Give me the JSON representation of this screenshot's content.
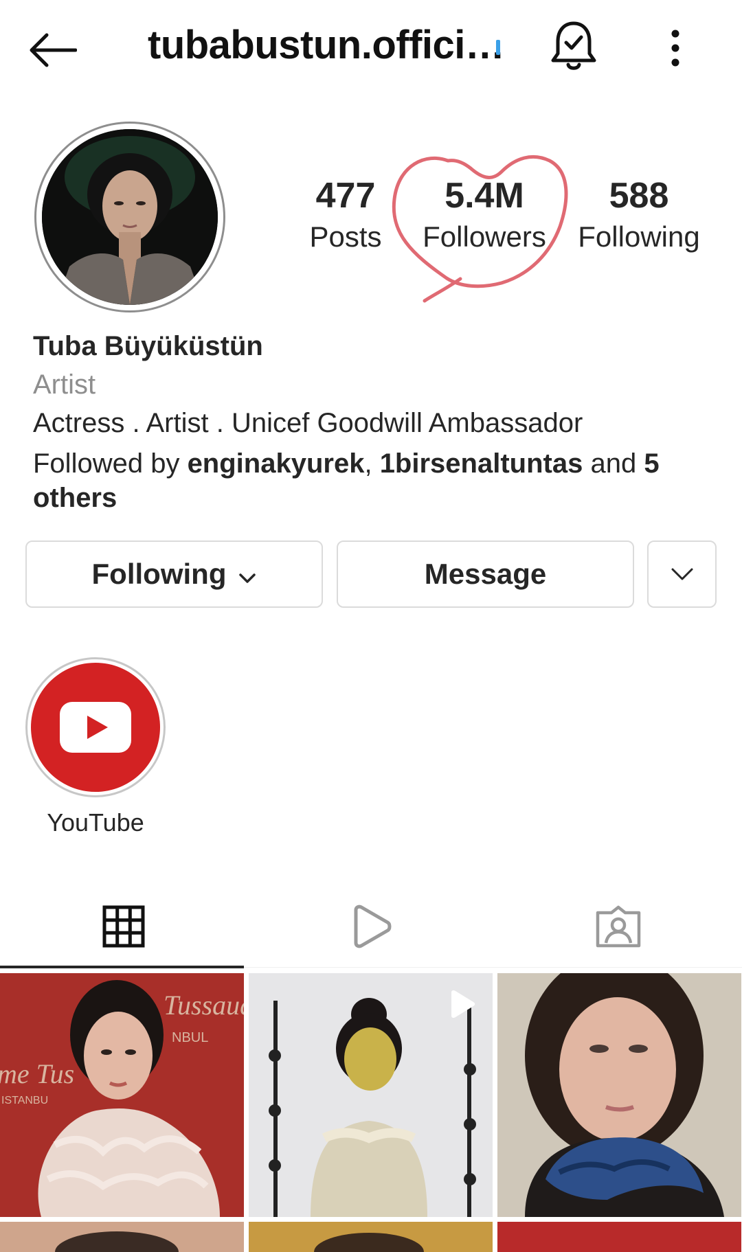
{
  "header": {
    "username": "tubabustun.offici…",
    "back_icon": "arrow-left-icon",
    "bell_icon": "bell-check-icon",
    "menu_icon": "more-vertical-icon"
  },
  "profile": {
    "stats": {
      "posts_value": "477",
      "posts_label": "Posts",
      "followers_value": "5.4M",
      "followers_label": "Followers",
      "following_value": "588",
      "following_label": "Following"
    },
    "full_name": "Tuba Büyüküstün",
    "category": "Artist",
    "bio": "Actress . Artist . Unicef Goodwill Ambassador",
    "followed_by": {
      "prefix": "Followed by ",
      "user1": "enginakyurek",
      "sep": ", ",
      "user2": "1birsenaltuntas",
      "and": " and ",
      "others": "5 others"
    }
  },
  "actions": {
    "following_label": "Following",
    "message_label": "Message"
  },
  "highlights": [
    {
      "label": "YouTube",
      "icon": "youtube-icon"
    }
  ],
  "tabs": [
    {
      "icon": "grid-icon",
      "active": true
    },
    {
      "icon": "reels-icon",
      "active": false
    },
    {
      "icon": "tagged-icon",
      "active": false
    }
  ],
  "grid": {
    "posts": [
      {
        "kind": "photo",
        "overlay_text_1": "Tussaud",
        "overlay_text_2": "NBUL",
        "overlay_text_3": "me Tus",
        "overlay_text_4": "ISTANBU"
      },
      {
        "kind": "reel"
      },
      {
        "kind": "photo"
      }
    ]
  },
  "colors": {
    "annotation_heart": "#e06a73",
    "youtube_red": "#d32223",
    "secondary_text": "#8e8e8e",
    "border": "#dbdbdb"
  }
}
